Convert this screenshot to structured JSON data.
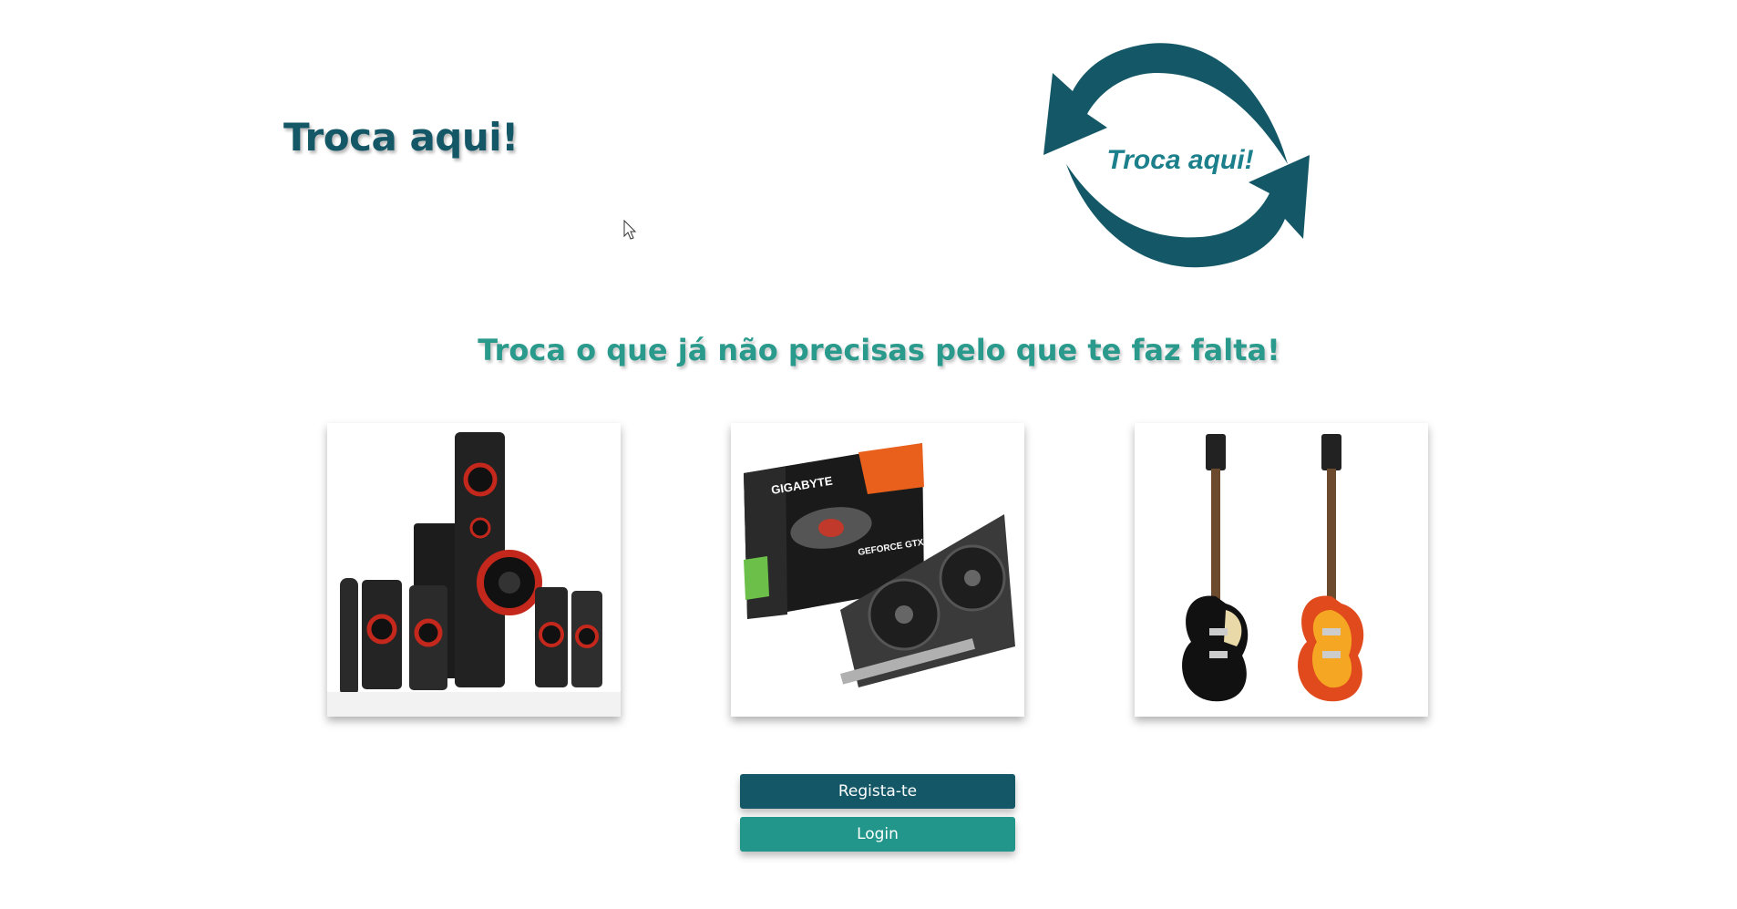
{
  "header": {
    "title": "Troca aqui!",
    "logo_text": "Troca aqui!",
    "logo_icon": "exchange-arrows-icon"
  },
  "hero": {
    "tagline": "Troca o que já não precisas pelo que te faz falta!"
  },
  "cards": [
    {
      "item": "speaker-system"
    },
    {
      "item": "graphics-card",
      "brand_text": "GIGABYTE",
      "product_text": "GEFORCE GTX"
    },
    {
      "item": "electric-guitars"
    }
  ],
  "actions": {
    "register_label": "Regista-te",
    "login_label": "Login"
  },
  "colors": {
    "primary": "#145867",
    "accent": "#22968b",
    "tagline": "#2a9a8d"
  }
}
